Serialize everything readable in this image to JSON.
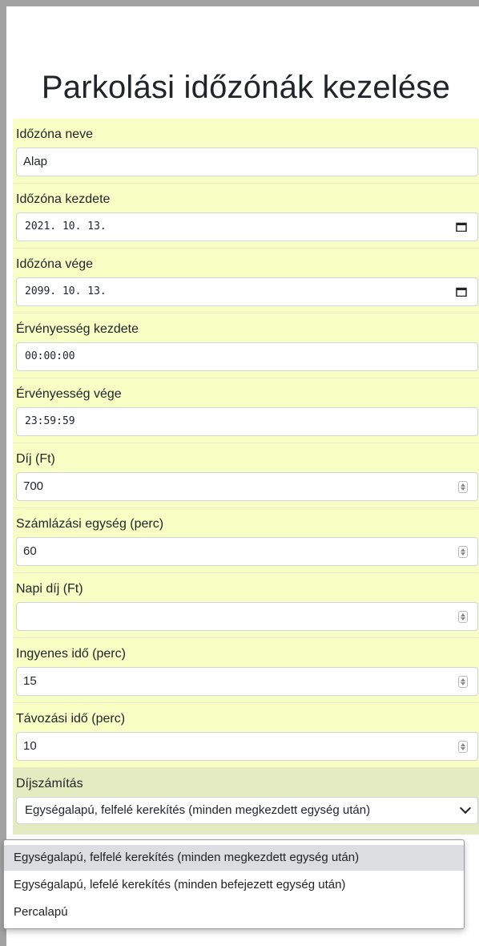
{
  "page": {
    "title": "Parkolási időzónák kezelése"
  },
  "fields": [
    {
      "label": "Időzóna neve",
      "value": "Alap",
      "kind": "text"
    },
    {
      "label": "Időzóna kezdete",
      "value": "2021. 10. 13.",
      "kind": "date"
    },
    {
      "label": "Időzóna vége",
      "value": "2099. 10. 13.",
      "kind": "date"
    },
    {
      "label": "Érvényesség kezdete",
      "value": "00:00:00",
      "kind": "time"
    },
    {
      "label": "Érvényesség vége",
      "value": "23:59:59",
      "kind": "time"
    },
    {
      "label": "Díj (Ft)",
      "value": "700",
      "kind": "number"
    },
    {
      "label": "Számlázási egység (perc)",
      "value": "60",
      "kind": "number"
    },
    {
      "label": "Napi díj (Ft)",
      "value": "",
      "kind": "number"
    },
    {
      "label": "Ingyenes idő (perc)",
      "value": "15",
      "kind": "number"
    },
    {
      "label": "Távozási idő (perc)",
      "value": "10",
      "kind": "number"
    }
  ],
  "pricing": {
    "label": "Díjszámítás",
    "selected": "Egységalapú, felfelé kerekítés (minden megkezdett egység után)",
    "options": [
      "Egységalapú, felfelé kerekítés (minden megkezdett egység után)",
      "Egységalapú, lefelé kerekítés (minden befejezett egység után)",
      "Percalapú"
    ]
  },
  "colors": {
    "form_bg": "#f7ffc4",
    "select_group_bg": "#e4ebc1",
    "highlight": "#dcdde1"
  },
  "icons": {
    "date": "calendar-icon",
    "number": "spinner-icon",
    "select": "chevron-down-icon"
  }
}
